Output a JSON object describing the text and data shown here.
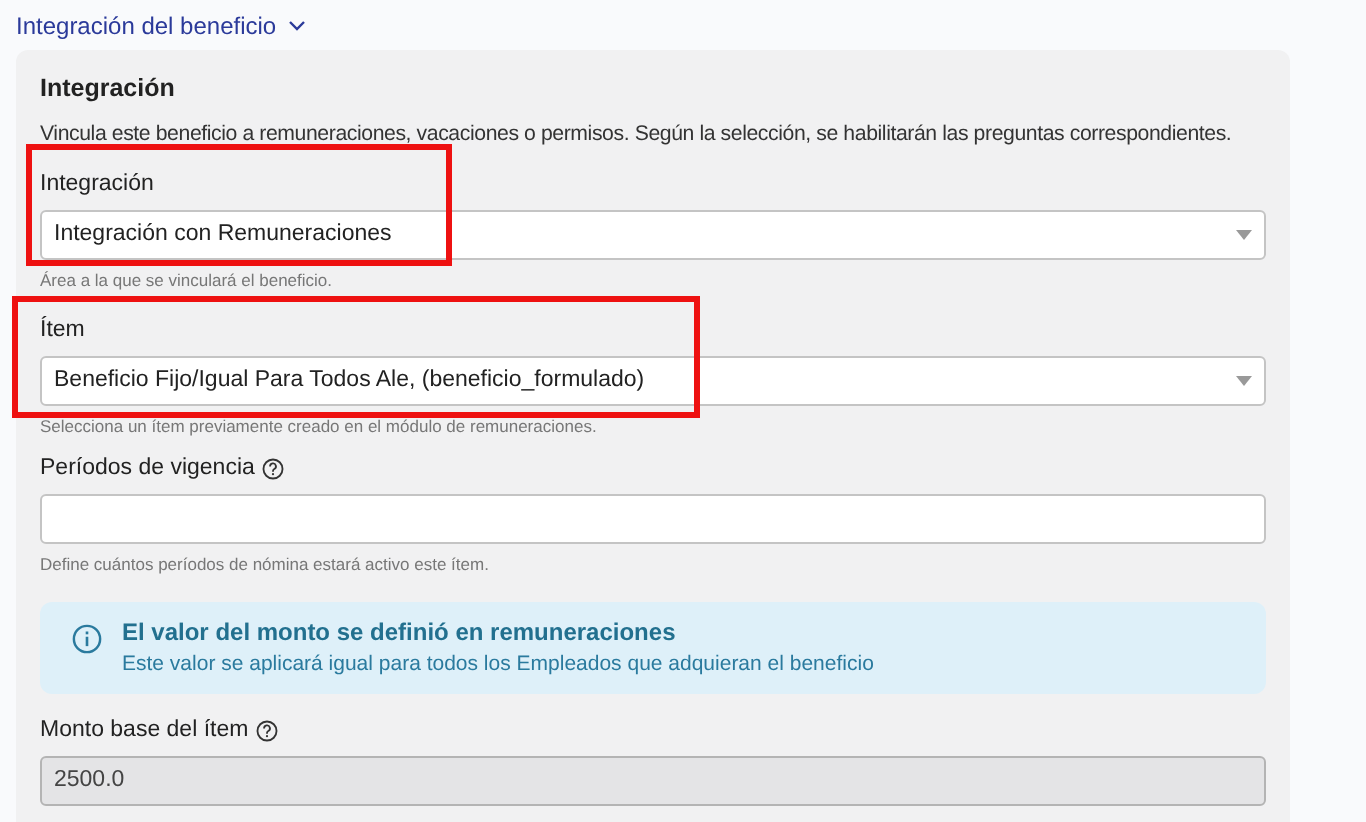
{
  "section": {
    "title": "Integración del beneficio",
    "expanded": true
  },
  "panel": {
    "title": "Integración",
    "description": "Vincula este beneficio a remuneraciones, vacaciones o permisos. Según la selección, se habilitarán las preguntas correspondientes."
  },
  "fields": [
    {
      "kind": "select",
      "label": "Integración",
      "value": "Integración con Remuneraciones",
      "help": "Área a la que se vinculará el beneficio.",
      "highlighted": true,
      "has_info": false,
      "disabled": false
    },
    {
      "kind": "select",
      "label": "Ítem",
      "value": "Beneficio Fijo/Igual Para Todos Ale, (beneficio_formulado)",
      "help": "Selecciona un ítem previamente creado en el módulo de remuneraciones.",
      "highlighted": true,
      "has_info": false,
      "disabled": false
    },
    {
      "kind": "text",
      "label": "Períodos de vigencia",
      "help": "Define cuántos períodos de nómina estará activo este ítem.",
      "highlighted": false,
      "has_info": true,
      "disabled": false
    },
    {
      "kind": "alert",
      "title": "El valor del monto se definió en remuneraciones",
      "message": "Este valor se aplicará igual para todos los Empleados que adquieran el beneficio"
    },
    {
      "kind": "text",
      "label": "Monto base del ítem",
      "value": "2500.0",
      "highlighted": false,
      "has_info": true,
      "disabled": true
    }
  ]
}
